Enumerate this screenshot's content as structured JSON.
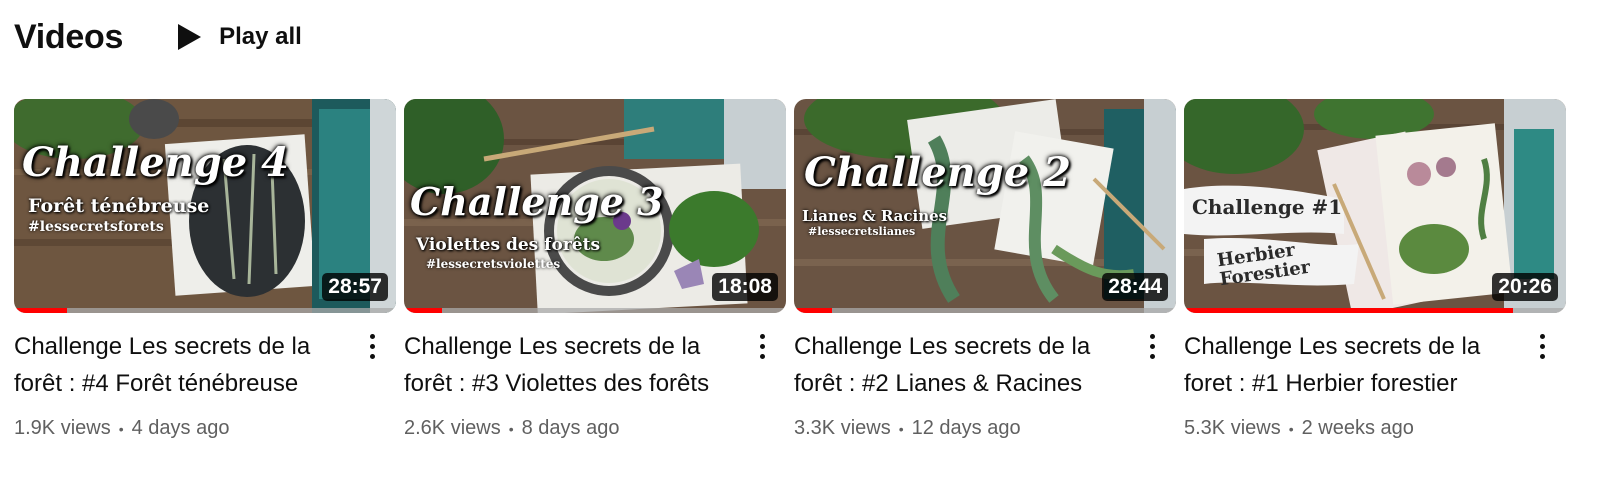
{
  "section": {
    "title": "Videos",
    "play_all_label": "Play all"
  },
  "icons": {
    "play": "play-icon",
    "more": "more-vert-icon"
  },
  "colors": {
    "progress": "#ff0000",
    "text_secondary": "#606060"
  },
  "videos": [
    {
      "thumb_title": "Challenge 4",
      "thumb_subtitle": "Forêt ténébreuse",
      "thumb_tag": "#lessecretsforets",
      "duration": "28:57",
      "progress": 0.14,
      "title": "Challenge Les secrets de la forêt : #4 Forêt ténébreuse",
      "views": "1.9K views",
      "age": "4 days ago"
    },
    {
      "thumb_title": "Challenge 3",
      "thumb_subtitle": "Violettes des forêts",
      "thumb_tag": "#lessecretsviolettes",
      "duration": "18:08",
      "progress": 0.1,
      "title": "Challenge Les secrets de la forêt : #3 Violettes des forêts",
      "views": "2.6K views",
      "age": "8 days ago"
    },
    {
      "thumb_title": "Challenge 2",
      "thumb_subtitle": "Lianes & Racines",
      "thumb_tag": "#lessecretslianes",
      "duration": "28:44",
      "progress": 0.1,
      "title": "Challenge Les secrets de la forêt : #2 Lianes & Racines",
      "views": "3.3K views",
      "age": "12 days ago"
    },
    {
      "thumb_title": "Challenge #1",
      "thumb_subtitle": "Herbier Forestier",
      "thumb_tag": "",
      "duration": "20:26",
      "progress": 0.86,
      "title": "Challenge Les secrets de la foret : #1 Herbier forestier",
      "views": "5.3K views",
      "age": "2 weeks ago"
    }
  ]
}
